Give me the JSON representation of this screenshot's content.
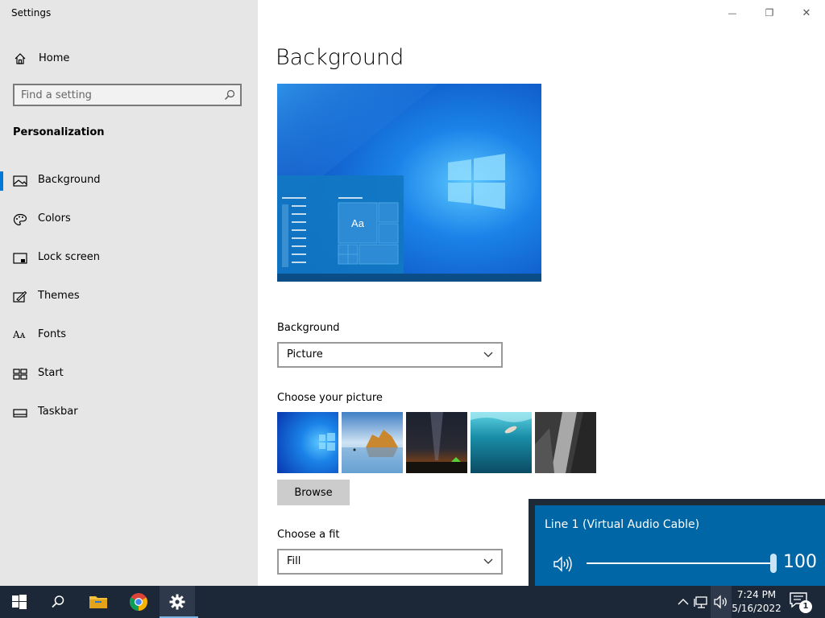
{
  "window": {
    "title": "Settings",
    "minimize_glyph": "—",
    "restore_glyph": "❐",
    "close_glyph": "✕"
  },
  "sidebar": {
    "home_label": "Home",
    "search_placeholder": "Find a setting",
    "section_title": "Personalization",
    "items": [
      {
        "label": "Background",
        "icon": "picture-icon",
        "active": true
      },
      {
        "label": "Colors",
        "icon": "palette-icon",
        "active": false
      },
      {
        "label": "Lock screen",
        "icon": "lock-screen-icon",
        "active": false
      },
      {
        "label": "Themes",
        "icon": "themes-icon",
        "active": false
      },
      {
        "label": "Fonts",
        "icon": "fonts-icon",
        "active": false
      },
      {
        "label": "Start",
        "icon": "start-icon",
        "active": false
      },
      {
        "label": "Taskbar",
        "icon": "taskbar-icon",
        "active": false
      }
    ],
    "fonts_icon_glyph": "Aᴀ"
  },
  "main": {
    "page_title": "Background",
    "preview": {
      "tile_text": "Aa"
    },
    "background_label": "Background",
    "background_value": "Picture",
    "choose_picture_label": "Choose your picture",
    "thumbnails": [
      "windows-blue",
      "beach-rocks",
      "night-sky-tent",
      "underwater-swimmer",
      "rock-cliff"
    ],
    "browse_label": "Browse",
    "choose_fit_label": "Choose a fit",
    "fit_value": "Fill"
  },
  "volume_flyout": {
    "device_name": "Line 1 (Virtual Audio Cable)",
    "volume_value": "100",
    "volume_level": 100
  },
  "taskbar": {
    "apps": [
      "start-button",
      "search-button",
      "file-explorer",
      "chrome",
      "settings"
    ],
    "active_app": "settings",
    "time": "7:24 PM",
    "date": "5/16/2022",
    "notification_count": "1"
  },
  "colors": {
    "accent": "#0078d7",
    "sidebar_bg": "#e6e6e6",
    "taskbar_bg": "#1c2838",
    "flyout_bg": "#0066a6"
  }
}
